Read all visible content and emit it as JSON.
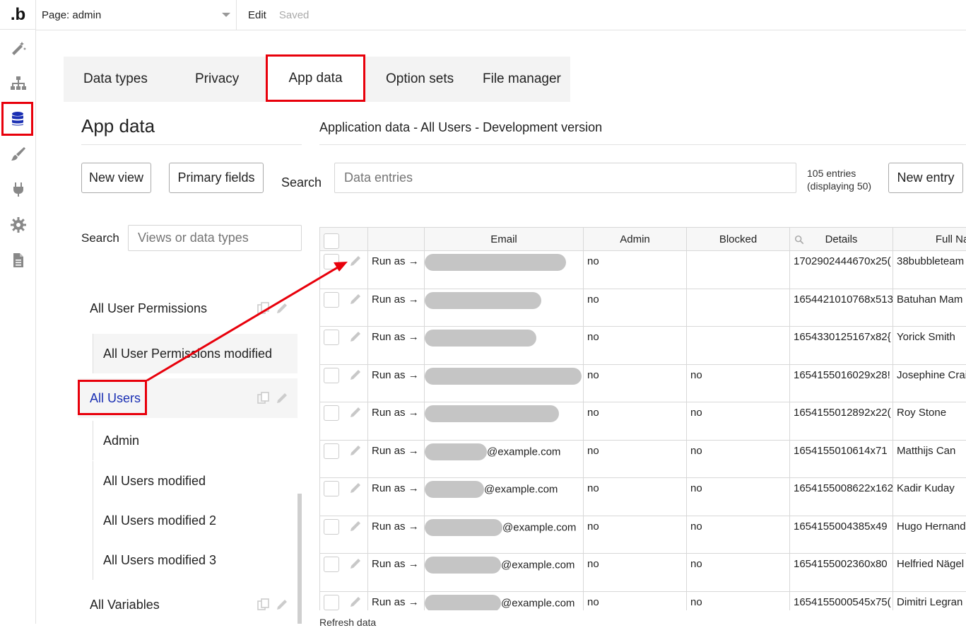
{
  "topbar": {
    "logo": ".b",
    "page_select": "Page: admin",
    "edit": "Edit",
    "saved": "Saved"
  },
  "rail": {
    "icons": [
      "design-icon",
      "workflow-icon",
      "data-icon",
      "styles-icon",
      "plugins-icon",
      "settings-icon",
      "logs-icon"
    ],
    "active": "data-icon"
  },
  "tabs": [
    {
      "label": "Data types"
    },
    {
      "label": "Privacy"
    },
    {
      "label": "App data"
    },
    {
      "label": "Option sets"
    },
    {
      "label": "File manager"
    }
  ],
  "left": {
    "title": "App data",
    "new_view": "New view",
    "primary_fields": "Primary fields",
    "search_label": "Search",
    "search_placeholder": "Views or data types",
    "views": [
      {
        "label": "All User Permissions"
      },
      {
        "label": "All User Permissions modified"
      },
      {
        "label": "All Users"
      },
      {
        "label": "Admin"
      },
      {
        "label": "All Users modified"
      },
      {
        "label": "All Users modified 2"
      },
      {
        "label": "All Users modified 3"
      },
      {
        "label": "All Variables"
      }
    ]
  },
  "right": {
    "title": "Application data - All Users - Development version",
    "search_label": "Search",
    "search_placeholder": "Data entries",
    "entries_line1": "105 entries",
    "entries_line2": "(displaying 50)",
    "new_entry": "New entry",
    "refresh": "Refresh data"
  },
  "table": {
    "columns": [
      "Email",
      "Admin",
      "Blocked",
      "Details",
      "Full Name"
    ],
    "run_as": "Run as →",
    "rows": [
      {
        "email": "",
        "admin": "no",
        "blocked": "",
        "details": "1702902444670x25(",
        "name": "38bubbleteam"
      },
      {
        "email": "",
        "admin": "no",
        "blocked": "",
        "details": "1654421010768x513",
        "name": "Batuhan Mam"
      },
      {
        "email": "",
        "admin": "no",
        "blocked": "",
        "details": "1654330125167x82{",
        "name": "Yorick Smith"
      },
      {
        "email": "",
        "admin": "no",
        "blocked": "no",
        "details": "1654155016029x28!",
        "name": "Josephine Crai"
      },
      {
        "email": "",
        "admin": "no",
        "blocked": "no",
        "details": "1654155012892x22(",
        "name": "Roy Stone"
      },
      {
        "email": "@example.com",
        "admin": "no",
        "blocked": "no",
        "details": "1654155010614x71",
        "name": "Matthijs Can"
      },
      {
        "email": "@example.com",
        "admin": "no",
        "blocked": "no",
        "details": "1654155008622x162",
        "name": "Kadir Kuday"
      },
      {
        "email": "@example.com",
        "admin": "no",
        "blocked": "no",
        "details": "1654155004385x49",
        "name": "Hugo Hernand"
      },
      {
        "email": "@example.com",
        "admin": "no",
        "blocked": "no",
        "details": "1654155002360x80",
        "name": "Helfried Nägel"
      },
      {
        "email": "@example.com",
        "admin": "no",
        "blocked": "no",
        "details": "1654155000545x75(",
        "name": "Dimitri Legran"
      }
    ]
  }
}
